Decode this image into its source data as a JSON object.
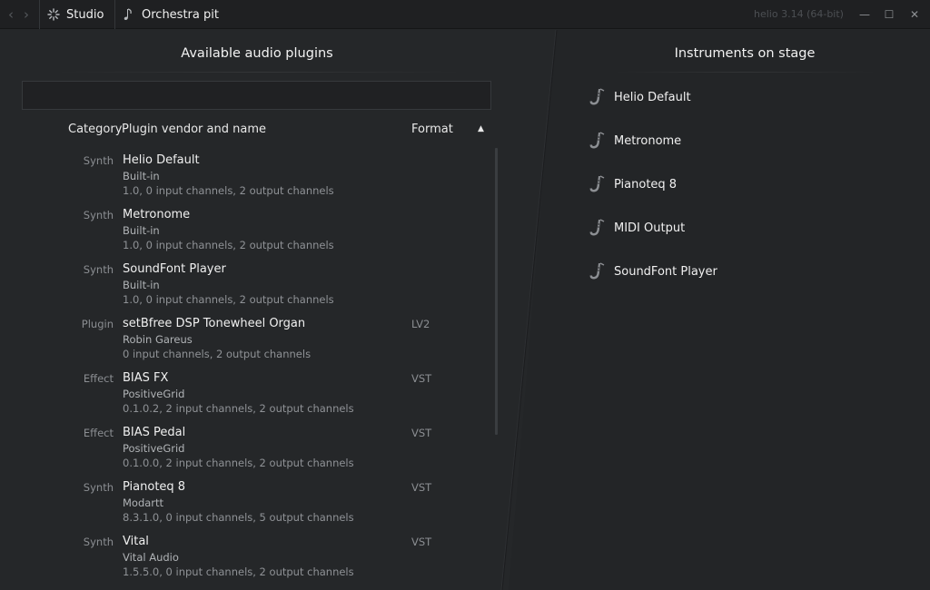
{
  "titlebar": {
    "breadcrumbs": [
      {
        "label": "Studio",
        "icon": "studio-icon"
      },
      {
        "label": "Orchestra pit",
        "icon": "orchestra-icon"
      }
    ],
    "version": "helio 3.14 (64-bit)",
    "window_controls": [
      "minimize-icon",
      "maximize-icon",
      "close-icon"
    ]
  },
  "plugins_panel": {
    "title": "Available audio plugins",
    "search_value": "",
    "columns": {
      "category": "Category",
      "name": "Plugin vendor and name",
      "format": "Format",
      "sort_indicator": "▲"
    },
    "plugins": [
      {
        "category": "Synth",
        "name": "Helio Default",
        "vendor": "Built-in",
        "description": "1.0, 0 input channels, 2 output channels",
        "format": ""
      },
      {
        "category": "Synth",
        "name": "Metronome",
        "vendor": "Built-in",
        "description": "1.0, 0 input channels, 2 output channels",
        "format": ""
      },
      {
        "category": "Synth",
        "name": "SoundFont Player",
        "vendor": "Built-in",
        "description": "1.0, 0 input channels, 2 output channels",
        "format": ""
      },
      {
        "category": "Plugin",
        "name": "setBfree DSP Tonewheel Organ",
        "vendor": "Robin Gareus",
        "description": "0 input channels, 2 output channels",
        "format": "LV2"
      },
      {
        "category": "Effect",
        "name": "BIAS FX",
        "vendor": "PositiveGrid",
        "description": "0.1.0.2, 2 input channels, 2 output channels",
        "format": "VST"
      },
      {
        "category": "Effect",
        "name": "BIAS Pedal",
        "vendor": "PositiveGrid",
        "description": "0.1.0.0, 2 input channels, 2 output channels",
        "format": "VST"
      },
      {
        "category": "Synth",
        "name": "Pianoteq 8",
        "vendor": "Modartt",
        "description": "8.3.1.0, 0 input channels, 5 output channels",
        "format": "VST"
      },
      {
        "category": "Synth",
        "name": "Vital",
        "vendor": "Vital Audio",
        "description": "1.5.5.0, 0 input channels, 2 output channels",
        "format": "VST"
      }
    ]
  },
  "instruments_panel": {
    "title": "Instruments on stage",
    "instruments": [
      {
        "name": "Helio Default",
        "icon": "saxophone-icon"
      },
      {
        "name": "Metronome",
        "icon": "saxophone-icon"
      },
      {
        "name": "Pianoteq 8",
        "icon": "saxophone-icon"
      },
      {
        "name": "MIDI Output",
        "icon": "saxophone-icon"
      },
      {
        "name": "SoundFont Player",
        "icon": "saxophone-icon"
      }
    ]
  },
  "colors": {
    "background": "#252729",
    "titlebar": "#1f2022",
    "text": "#f0f0f0",
    "muted_text": "#8b8e92"
  }
}
